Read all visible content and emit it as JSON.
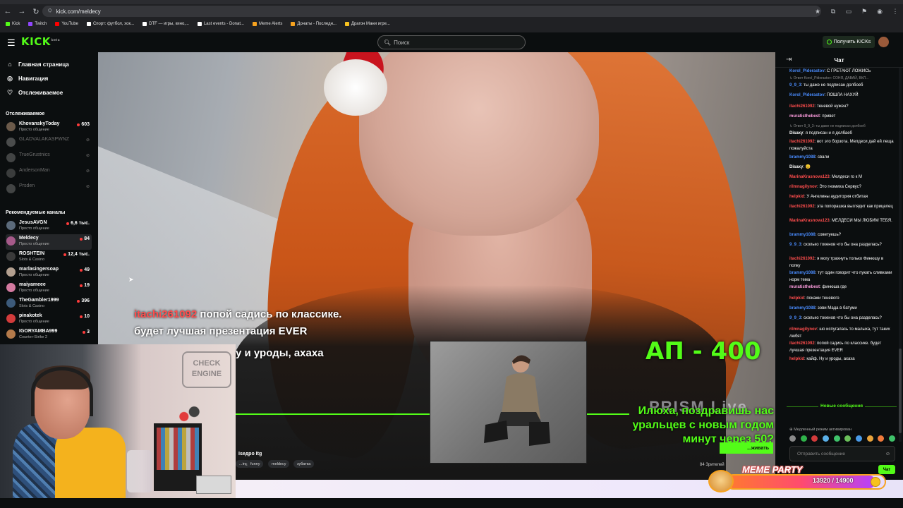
{
  "browser": {
    "url": "kick.com/meldecy",
    "bookmarks": [
      {
        "label": "Kick",
        "color": "#53fc18"
      },
      {
        "label": "Twitch",
        "color": "#9146ff"
      },
      {
        "label": "YouTube",
        "color": "#ff0000"
      },
      {
        "label": "Спорт: футбол, хок...",
        "color": "#ffffff"
      },
      {
        "label": "DTF — игры, кино,...",
        "color": "#ffffff"
      },
      {
        "label": "Last events - Donat...",
        "color": "#ffffff"
      },
      {
        "label": "Meme Alerts",
        "color": "#f6a21f"
      },
      {
        "label": "Донаты - Последн...",
        "color": "#f6a21f"
      },
      {
        "label": "Драгон Мани игре...",
        "color": "#f7c21f"
      }
    ]
  },
  "header": {
    "logo": "KICK",
    "logo_sup": "beta",
    "search_placeholder": "Поиск",
    "get_kicks": "Получить KICKs"
  },
  "sidebar": {
    "nav": [
      {
        "label": "Главная страница",
        "icon": "home-icon"
      },
      {
        "label": "Навигация",
        "icon": "compass-icon"
      },
      {
        "label": "Отслеживаемое",
        "icon": "heart-icon"
      }
    ],
    "following_title": "Отслеживаемое",
    "following": [
      {
        "name": "KhovanskyToday",
        "category": "Просто общение",
        "viewers": "603",
        "online": true
      },
      {
        "name": "GLADVALAKASPWNZ",
        "category": "",
        "viewers": "",
        "online": false
      },
      {
        "name": "TrueGrustnics",
        "category": "",
        "viewers": "",
        "online": false
      },
      {
        "name": "AndersonMan",
        "category": "",
        "viewers": "",
        "online": false
      },
      {
        "name": "Prsden",
        "category": "",
        "viewers": "",
        "online": false
      }
    ],
    "recommended_title": "Рекомендуемые каналы",
    "recommended": [
      {
        "name": "JesusAVGN",
        "category": "Просто общение",
        "viewers": "6,6 тыс."
      },
      {
        "name": "Meldecy",
        "category": "Просто общение",
        "viewers": "84"
      },
      {
        "name": "ROSHTEIN",
        "category": "Slots & Casino",
        "viewers": "12,4 тыс."
      },
      {
        "name": "marlasingersoap",
        "category": "Просто общение",
        "viewers": "49"
      },
      {
        "name": "maiyameee",
        "category": "Просто общение",
        "viewers": "19"
      },
      {
        "name": "TheGambler1999",
        "category": "Slots & Casino",
        "viewers": "396"
      },
      {
        "name": "pinakotek",
        "category": "Просто общение",
        "viewers": "10"
      },
      {
        "name": "IGORYAMBA999",
        "category": "Counter-Strike 2",
        "viewers": "3"
      }
    ]
  },
  "video": {
    "overlay_user": "itachi261092",
    "overlay_line1": "попой садись по классике.",
    "overlay_line2": "будет лучшая презентация EVER",
    "overlay_line3": "у и уроды, ахаха",
    "ap_label": "АП - 400",
    "prism": "PRISM Live",
    "congrats": "Илюха, поздравишь нас уральцев с новым годом минут через 50?",
    "sub_button": "...живать",
    "stream_title": "Іsедро Itg",
    "tags": [
      "...ing",
      "funny",
      "meldecy",
      "зубатка"
    ],
    "viewers": "84 Зрителей"
  },
  "chat": {
    "title": "Чат",
    "messages": [
      {
        "user": "Korol_Piderastov",
        "color": "#4a8cff",
        "text": "С ГРЕТАЮТ ЛОЖИСЬ",
        "reply": ""
      },
      {
        "user": "",
        "color": "#8a8a8a",
        "text": "",
        "reply": "↳ Ответ Korol_Piderastov: СОНЯ, ДАВАЙ, ВКЛ..."
      },
      {
        "user": "9_9_3",
        "color": "#4a8cff",
        "text": "ты даже не подписан долбоеб",
        "reply": ""
      },
      {
        "user": "Korol_Piderastov",
        "color": "#4a8cff",
        "text": "ПОШЛА НАХУЙ",
        "reply": ""
      },
      {
        "user": "itachi261092",
        "color": "#ff4d4d",
        "text": "теневой нужен?",
        "reply": ""
      },
      {
        "user": "muratisthebest",
        "color": "#ff9ee0",
        "text": "привет",
        "reply": ""
      },
      {
        "user": "",
        "color": "#8a8a8a",
        "text": "",
        "reply": "↳ Ответ 9_9_3: ты даже не подписан долбоеб"
      },
      {
        "user": "Disaxy",
        "color": "#ffffff",
        "text": "я подписан и я долбаеб",
        "reply": ""
      },
      {
        "user": "itachi261092",
        "color": "#ff4d4d",
        "text": "вот это борзота. Мелдеси дай ей леща пожалуйста",
        "reply": ""
      },
      {
        "user": "brammy1088",
        "color": "#4a8cff",
        "text": "свали",
        "reply": ""
      },
      {
        "user": "Disaxy",
        "color": "#ffffff",
        "text": "😊",
        "reply": ""
      },
      {
        "user": "MarinaKrasnova123",
        "color": "#ff4d4d",
        "text": "Мелдеси го к М",
        "reply": ""
      },
      {
        "user": "rilmnagilynov",
        "color": "#ff4d4d",
        "text": "Это гномиха Сервус?",
        "reply": ""
      },
      {
        "user": "helpkid",
        "color": "#ff4d4d",
        "text": "У Ангелины аудитория отбитая",
        "reply": ""
      },
      {
        "user": "itachi261092",
        "color": "#ff4d4d",
        "text": "эта попорашка выглядит как прицелец",
        "reply": ""
      },
      {
        "user": "MarinaKrasnova123",
        "color": "#ff4d4d",
        "text": "МЕЛДЕСИ МЫ ЛЮБИМ ТЕБЯ.",
        "reply": ""
      },
      {
        "user": "brammy1088",
        "color": "#4a8cff",
        "text": "советуешь?",
        "reply": ""
      },
      {
        "user": "9_9_3",
        "color": "#4a8cff",
        "text": "сколько токенов что бы она разделась?",
        "reply": ""
      },
      {
        "user": "itachi261092",
        "color": "#ff4d4d",
        "text": "я могу трахнуть только Финюшу в попку",
        "reply": ""
      },
      {
        "user": "brammy1088",
        "color": "#4a8cff",
        "text": "тут один говорит что пукать сливками норм тема",
        "reply": ""
      },
      {
        "user": "muratisthebest",
        "color": "#ff9ee0",
        "text": "финюша где",
        "reply": ""
      },
      {
        "user": "helpkid",
        "color": "#ff4d4d",
        "text": "покажи теневого",
        "reply": ""
      },
      {
        "user": "brammy1088",
        "color": "#4a8cff",
        "text": "зови Мада в батуми",
        "reply": ""
      },
      {
        "user": "9_9_3",
        "color": "#4a8cff",
        "text": "сколько токенов что бы она разделась?",
        "reply": ""
      },
      {
        "user": "rilmnagilynov",
        "color": "#ff4d4d",
        "text": "шо испугалась то малыха, тут таких любят",
        "reply": ""
      },
      {
        "user": "itachi261092",
        "color": "#ff4d4d",
        "text": "попой садись по классике. будет лучшая презентация EVER",
        "reply": ""
      },
      {
        "user": "helpkid",
        "color": "#ff4d4d",
        "text": "кайф. Ну и уроды, ахаха",
        "reply": ""
      }
    ],
    "new_messages": "Новые сообщения",
    "slow_mode": "⊕ Медленный режим активирован",
    "input_placeholder": "Отправить сообщение",
    "send": "Чат"
  },
  "meme_party": {
    "title": "MEME PARTY",
    "value": "13920 / 14900",
    "progress": 0.934
  }
}
